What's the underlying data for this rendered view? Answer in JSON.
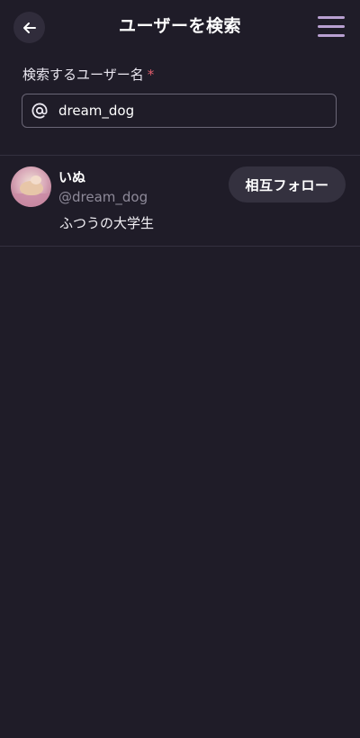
{
  "header": {
    "title": "ユーザーを検索",
    "back_icon": "arrow-left-icon",
    "menu_icon": "hamburger-menu-icon"
  },
  "search": {
    "label": "検索するユーザー名",
    "required_mark": "*",
    "prefix_icon": "at-sign-icon",
    "value": "dream_dog"
  },
  "results": [
    {
      "display_name": "いぬ",
      "handle": "@dream_dog",
      "bio": "ふつうの大学生",
      "follow_label": "相互フォロー"
    }
  ],
  "colors": {
    "background": "#1f1c28",
    "accent": "#b9a0d2",
    "required": "#e15d6c",
    "button_bg": "#34313f"
  }
}
